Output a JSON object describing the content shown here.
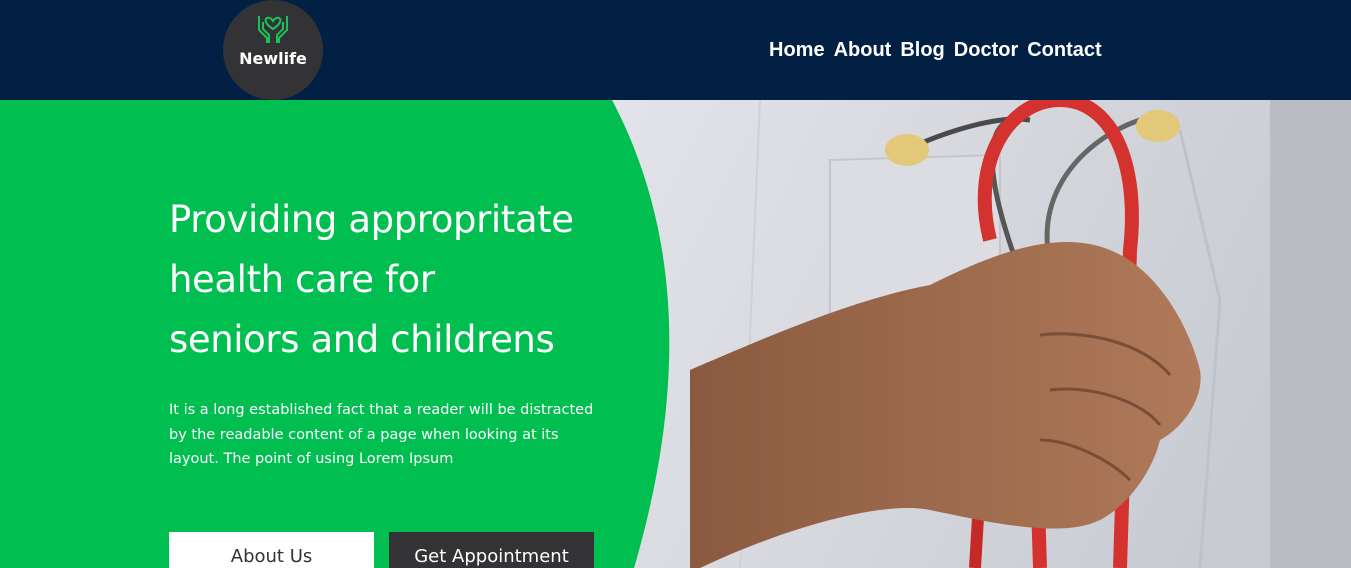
{
  "brand": {
    "name": "Newlife",
    "icon": "hands-heart-icon",
    "accent_color": "#00bf50",
    "header_color": "#022044"
  },
  "nav": {
    "items": [
      "Home",
      "About",
      "Blog",
      "Doctor",
      "Contact"
    ]
  },
  "hero": {
    "title_lines": [
      "Providing appropritate",
      "health care for",
      "seniors and childrens"
    ],
    "description": "It is a long established fact that a reader will be distracted by the readable content of a page when looking at its layout. The point of using Lorem Ipsum",
    "image": "doctor-holding-stethoscope-image",
    "buttons": {
      "about": "About Us",
      "appointment": "Get Appointment"
    }
  }
}
